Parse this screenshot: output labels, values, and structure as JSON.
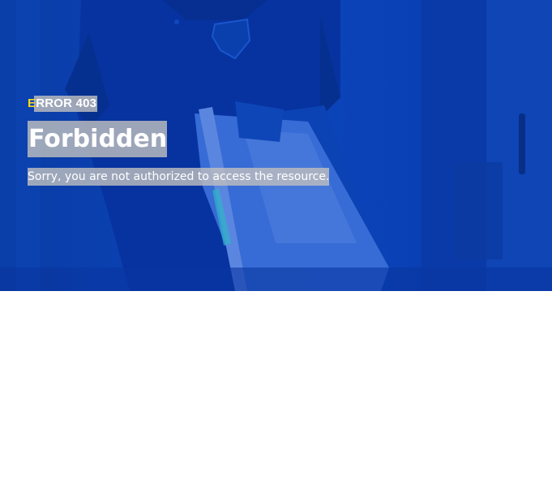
{
  "hero": {
    "error_code_first": "E",
    "error_code_rest": "RROR 403",
    "title": "Forbidden",
    "message": "Sorry, you are not authorized to access the resource."
  },
  "colors": {
    "overlay": "#0a3fb0",
    "accent": "#f6d81c",
    "text": "#ffffff",
    "highlight": "#bebebe",
    "page_background": "#ffffff"
  },
  "icons": {
    "background": "delivery-person-photo"
  }
}
